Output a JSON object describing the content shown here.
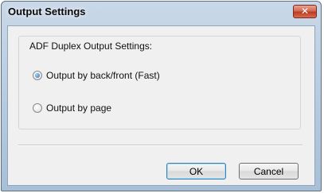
{
  "window": {
    "title": "Output Settings"
  },
  "group": {
    "label": "ADF Duplex Output Settings:",
    "options": [
      {
        "label": "Output by back/front (Fast)",
        "checked": true
      },
      {
        "label": "Output by page",
        "checked": false
      }
    ]
  },
  "buttons": {
    "ok": "OK",
    "cancel": "Cancel"
  },
  "icons": {
    "close": "close-icon"
  }
}
